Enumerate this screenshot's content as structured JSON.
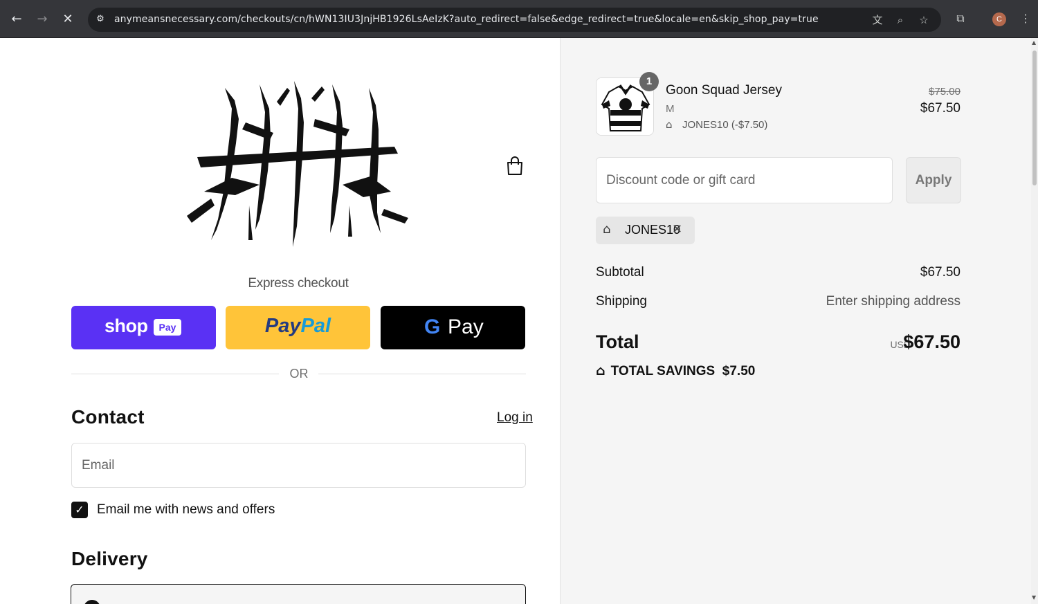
{
  "browser": {
    "url": "anymeansnecessary.com/checkouts/cn/hWN13IU3JnjHB1926LsAeIzK?auto_redirect=false&edge_redirect=true&locale=en&skip_shop_pay=true",
    "profile_initial": "C",
    "icons": {
      "back": "back-arrow-icon",
      "forward": "forward-arrow-icon",
      "stop": "stop-loading-icon",
      "site_info": "site-info-icon",
      "translate": "translate-icon",
      "zoom": "zoom-icon",
      "bookmark": "bookmark-star-icon",
      "extensions": "extensions-icon",
      "menu": "kebab-menu-icon"
    }
  },
  "checkout": {
    "express_label": "Express checkout",
    "buttons": {
      "shop_word": "shop",
      "shop_badge": "Pay",
      "paypal_a": "Pay",
      "paypal_b": "Pal",
      "gpay_g": "G",
      "gpay_word": "Pay"
    },
    "or_label": "OR",
    "contact": {
      "heading": "Contact",
      "login": "Log in",
      "email_placeholder": "Email",
      "news_label": "Email me with news and offers",
      "news_checked": true
    },
    "delivery": {
      "heading": "Delivery"
    }
  },
  "summary": {
    "product": {
      "name": "Goon Squad Jersey",
      "variant": "M",
      "discount": "JONES10 (-$7.50)",
      "quantity": "1",
      "original_price": "$75.00",
      "price": "$67.50"
    },
    "discount_placeholder": "Discount code or gift card",
    "apply": "Apply",
    "applied_code": "JONES10",
    "subtotal_label": "Subtotal",
    "subtotal": "$67.50",
    "shipping_label": "Shipping",
    "shipping": "Enter shipping address",
    "total_label": "Total",
    "currency": "USD",
    "total": "$67.50",
    "savings_label": "TOTAL SAVINGS",
    "savings": "$7.50"
  },
  "colors": {
    "shop_pay": "#5a31f4",
    "paypal": "#ffc439",
    "gpay": "#000000",
    "summary_bg": "#f5f5f5"
  }
}
